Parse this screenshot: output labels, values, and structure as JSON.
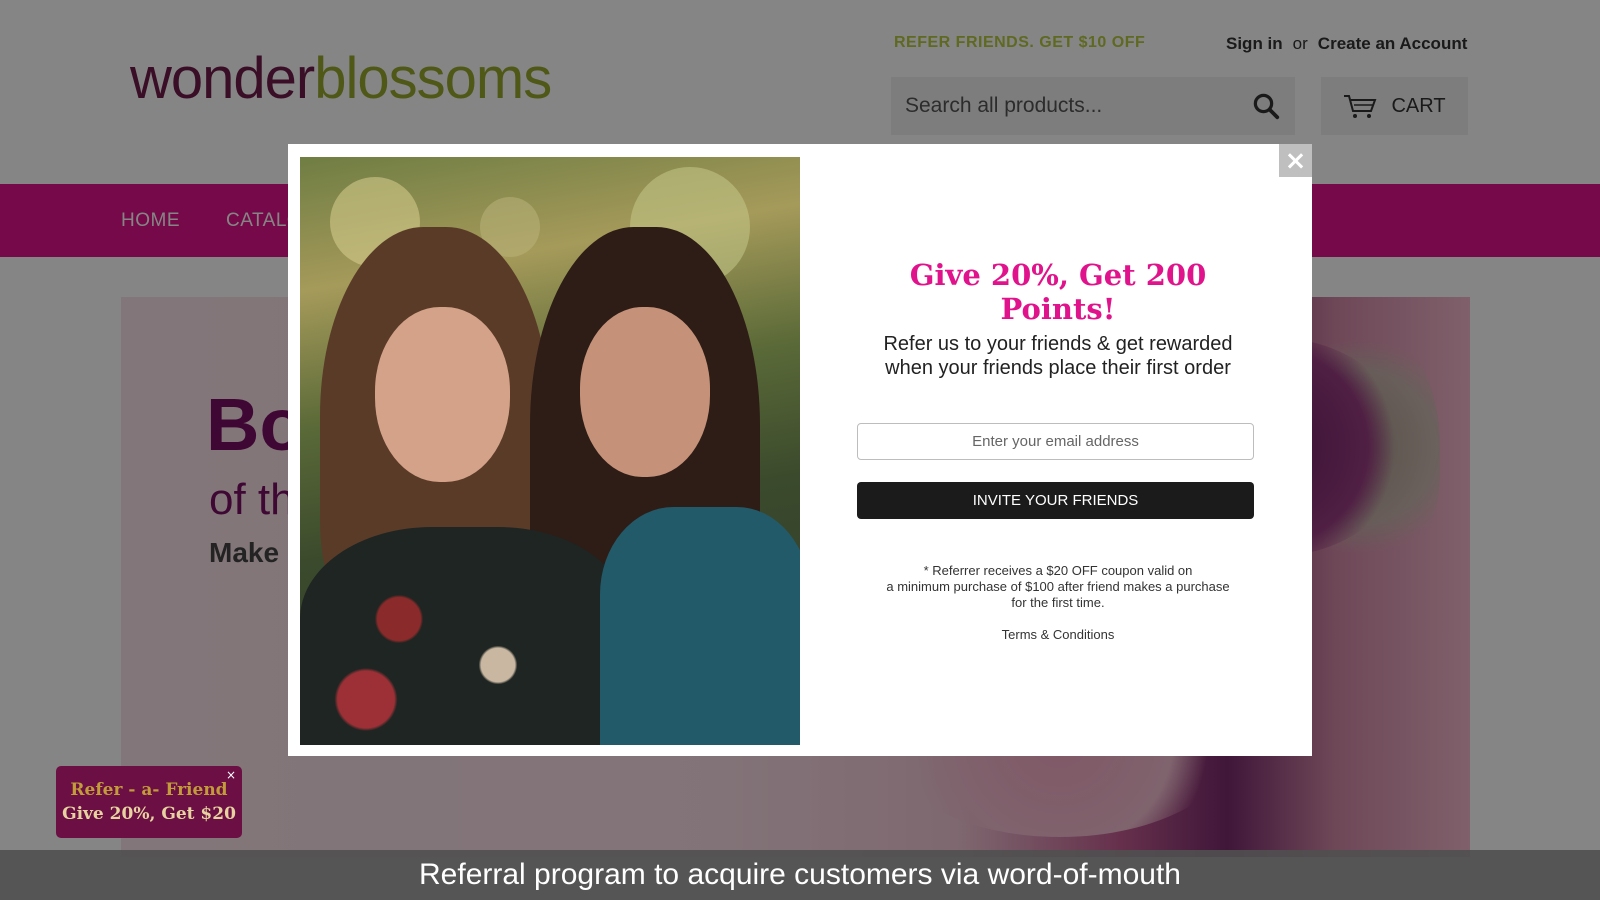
{
  "brand": {
    "logo_part1": "wonder",
    "logo_part2": "blossoms",
    "logo_color_1": "#6e1b4a",
    "logo_color_2": "#9aaa2e"
  },
  "header": {
    "promo_link": "REFER FRIENDS. GET $10 OFF",
    "sign_in": "Sign in",
    "or": "or",
    "create_account": "Create an Account",
    "search_placeholder": "Search all products...",
    "search_icon": "search-icon",
    "cart_label": "CART",
    "cart_icon": "cart-icon"
  },
  "nav": {
    "items": [
      "HOME",
      "CATALO"
    ],
    "color": "#e0138c"
  },
  "hero": {
    "title": "Bo",
    "subtitle": "of th",
    "tagline": "Make I"
  },
  "modal": {
    "close_label": "×",
    "title": "Give 20%, Get 200 Points!",
    "subtitle_line1": "Refer us to your friends & get rewarded",
    "subtitle_line2": "when your friends place their first order",
    "email_placeholder": "Enter your email address",
    "invite_button": "INVITE YOUR FRIENDS",
    "fine_print": "* Referrer receives a $20 OFF coupon valid on\na minimum purchase of $100 after friend makes a purchase\nfor the first time.",
    "terms_link": "Terms & Conditions",
    "accent_color": "#e0138c"
  },
  "badge": {
    "line1": "Refer - a- Friend",
    "line2": "Give 20%, Get $20",
    "close_label": "×",
    "background_color": "#6c0f44"
  },
  "caption": {
    "text": "Referral program to acquire customers via word-of-mouth"
  }
}
